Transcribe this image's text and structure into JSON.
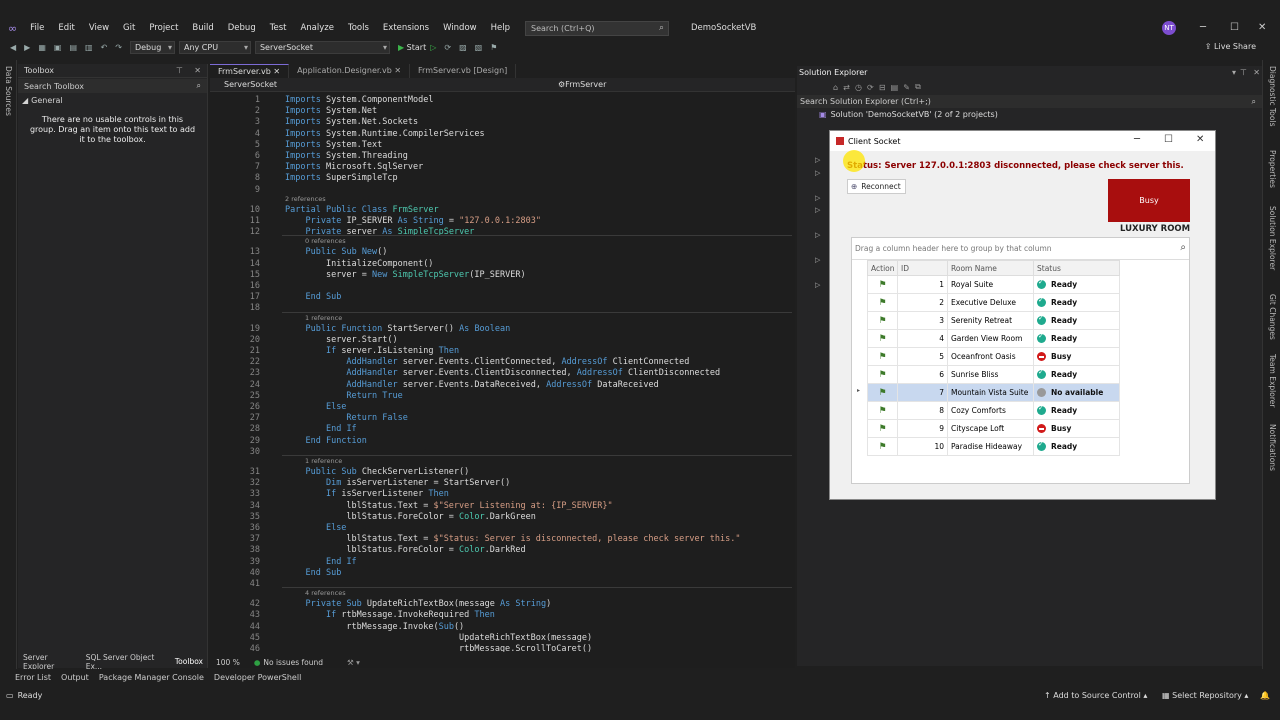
{
  "menu": [
    "File",
    "Edit",
    "View",
    "Git",
    "Project",
    "Build",
    "Debug",
    "Test",
    "Analyze",
    "Tools",
    "Extensions",
    "Window",
    "Help"
  ],
  "search_placeholder": "Search (Ctrl+Q)",
  "app_title": "DemoSocketVB",
  "avatar_initials": "NT",
  "toolbar": {
    "config": "Debug",
    "platform": "Any CPU",
    "project": "ServerSocket",
    "start": "Start",
    "live_share": "Live Share"
  },
  "left_strip": "Data Sources",
  "toolbox": {
    "title": "Toolbox",
    "search": "Search Toolbox",
    "group": "General",
    "message": "There are no usable controls in this group. Drag an item onto this text to add it to the toolbox."
  },
  "toolbox_tabs": [
    "Server Explorer",
    "SQL Server Object Ex...",
    "Toolbox"
  ],
  "doc_tabs": [
    "FrmServer.vb",
    "Application.Designer.vb",
    "FrmServer.vb [Design]"
  ],
  "nav": {
    "left": "ServerSocket",
    "right": "FrmServer"
  },
  "code_lines": [
    {
      "n": "1",
      "t": "Imports System.ComponentModel"
    },
    {
      "n": "2",
      "t": "Imports System.Net"
    },
    {
      "n": "3",
      "t": "Imports System.Net.Sockets"
    },
    {
      "n": "4",
      "t": "Imports System.Runtime.CompilerServices"
    },
    {
      "n": "5",
      "t": "Imports System.Text"
    },
    {
      "n": "6",
      "t": "Imports System.Threading"
    },
    {
      "n": "7",
      "t": "Imports Microsoft.SqlServer"
    },
    {
      "n": "8",
      "t": "Imports SuperSimpleTcp"
    },
    {
      "n": "9",
      "t": ""
    },
    {
      "n": "10",
      "t": "Partial Public Class FrmServer"
    },
    {
      "n": "11",
      "t": "    Private IP_SERVER As String = \"127.0.0.1:2803\""
    },
    {
      "n": "12",
      "t": "    Private server As SimpleTcpServer"
    },
    {
      "n": "13",
      "t": "    Public Sub New()"
    },
    {
      "n": "14",
      "t": "        InitializeComponent()"
    },
    {
      "n": "15",
      "t": "        server = New SimpleTcpServer(IP_SERVER)"
    },
    {
      "n": "16",
      "t": ""
    },
    {
      "n": "17",
      "t": "    End Sub"
    },
    {
      "n": "18",
      "t": ""
    },
    {
      "n": "19",
      "t": "    Public Function StartServer() As Boolean"
    },
    {
      "n": "20",
      "t": "        server.Start()"
    },
    {
      "n": "21",
      "t": "        If server.IsListening Then"
    },
    {
      "n": "22",
      "t": "            AddHandler server.Events.ClientConnected, AddressOf ClientConnected"
    },
    {
      "n": "23",
      "t": "            AddHandler server.Events.ClientDisconnected, AddressOf ClientDisconnected"
    },
    {
      "n": "24",
      "t": "            AddHandler server.Events.DataReceived, AddressOf DataReceived"
    },
    {
      "n": "25",
      "t": "            Return True"
    },
    {
      "n": "26",
      "t": "        Else"
    },
    {
      "n": "27",
      "t": "            Return False"
    },
    {
      "n": "28",
      "t": "        End If"
    },
    {
      "n": "29",
      "t": "    End Function"
    },
    {
      "n": "30",
      "t": ""
    },
    {
      "n": "31",
      "t": "    Public Sub CheckServerListener()"
    },
    {
      "n": "32",
      "t": "        Dim isServerListener = StartServer()"
    },
    {
      "n": "33",
      "t": "        If isServerListener Then"
    },
    {
      "n": "34",
      "t": "            lblStatus.Text = $\"Server Listening at: {IP_SERVER}\""
    },
    {
      "n": "35",
      "t": "            lblStatus.ForeColor = Color.DarkGreen"
    },
    {
      "n": "36",
      "t": "        Else"
    },
    {
      "n": "37",
      "t": "            lblStatus.Text = $\"Status: Server is disconnected, please check server this.\""
    },
    {
      "n": "38",
      "t": "            lblStatus.ForeColor = Color.DarkRed"
    },
    {
      "n": "39",
      "t": "        End If"
    },
    {
      "n": "40",
      "t": "    End Sub"
    },
    {
      "n": "41",
      "t": ""
    },
    {
      "n": "42",
      "t": "    Private Sub UpdateRichTextBox(message As String)"
    },
    {
      "n": "43",
      "t": "        If rtbMessage.InvokeRequired Then"
    },
    {
      "n": "44",
      "t": "            rtbMessage.Invoke(Sub()"
    },
    {
      "n": "45",
      "t": "                                  UpdateRichTextBox(message)"
    },
    {
      "n": "46",
      "t": "                                  rtbMessage.ScrollToCaret()"
    }
  ],
  "refs": {
    "class": "2 references",
    "ctor": "0 references",
    "start": "1 reference",
    "check": "1 reference",
    "update": "4 references"
  },
  "editor_status": {
    "zoom": "100 %",
    "issues": "No issues found"
  },
  "solution_explorer": {
    "title": "Solution Explorer",
    "search": "Search Solution Explorer (Ctrl+;)",
    "solution": "Solution 'DemoSocketVB' (2 of 2 projects)"
  },
  "right_strip": [
    "Diagnostic Tools",
    "Properties",
    "Solution Explorer",
    "Git Changes",
    "Team Explorer",
    "Notifications"
  ],
  "client": {
    "title": "Client Socket",
    "status": "Status: Server 127.0.0.1:2803 disconnected, please check server this.",
    "reconnect": "Reconnect",
    "busy_button": "Busy",
    "room_label": "LUXURY ROOM",
    "group_hint": "Drag a column header here to group by that column",
    "columns": [
      "Action",
      "ID",
      "Room Name",
      "Status"
    ],
    "rows": [
      {
        "id": "1",
        "name": "Royal Suite",
        "status": "Ready",
        "kind": "ok"
      },
      {
        "id": "2",
        "name": "Executive Deluxe",
        "status": "Ready",
        "kind": "ok"
      },
      {
        "id": "3",
        "name": "Serenity Retreat",
        "status": "Ready",
        "kind": "ok"
      },
      {
        "id": "4",
        "name": "Garden View Room",
        "status": "Ready",
        "kind": "ok"
      },
      {
        "id": "5",
        "name": "Oceanfront Oasis",
        "status": "Busy",
        "kind": "busy"
      },
      {
        "id": "6",
        "name": "Sunrise Bliss",
        "status": "Ready",
        "kind": "ok"
      },
      {
        "id": "7",
        "name": "Mountain Vista Suite",
        "status": "No available",
        "kind": "na",
        "selected": true
      },
      {
        "id": "8",
        "name": "Cozy Comforts",
        "status": "Ready",
        "kind": "ok"
      },
      {
        "id": "9",
        "name": "Cityscape Loft",
        "status": "Busy",
        "kind": "busy"
      },
      {
        "id": "10",
        "name": "Paradise Hideaway",
        "status": "Ready",
        "kind": "ok"
      }
    ]
  },
  "bottom_tabs": [
    "Error List",
    "Output",
    "Package Manager Console",
    "Developer PowerShell"
  ],
  "statusbar": {
    "ready": "Ready",
    "source": "Add to Source Control",
    "repo": "Select Repository"
  },
  "colors": {
    "accent": "#7c6bd6",
    "busy_red": "#a80e0e",
    "status_red": "#8b0000"
  }
}
